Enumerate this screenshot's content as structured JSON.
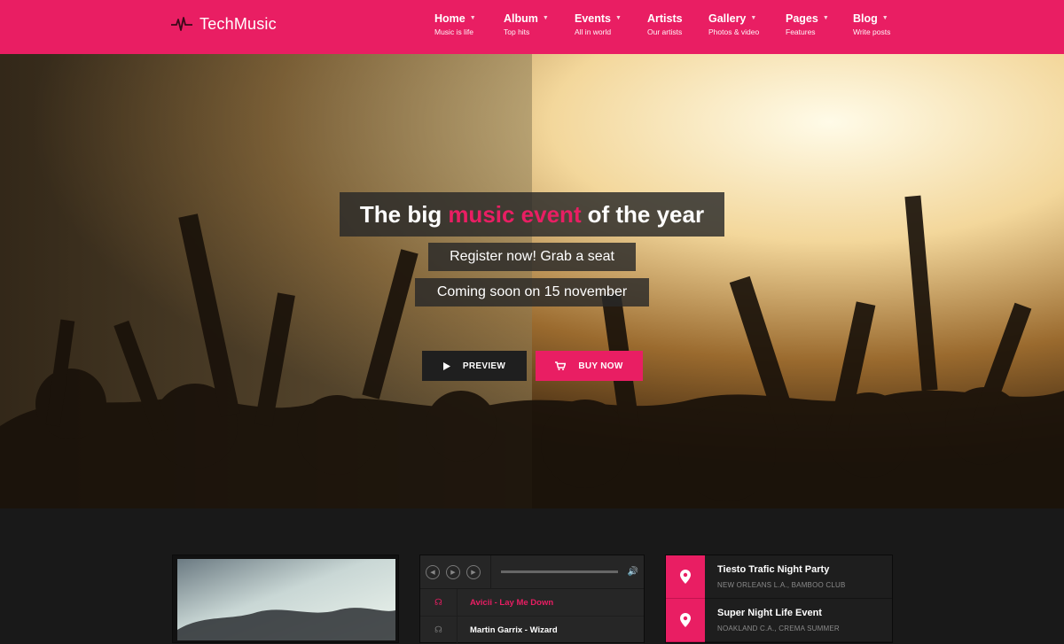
{
  "brand": {
    "name": "TechMusic",
    "logo_icon": "pulse-icon"
  },
  "nav": [
    {
      "title": "Home",
      "sub": "Music is life",
      "dropdown": true
    },
    {
      "title": "Album",
      "sub": "Top hits",
      "dropdown": true
    },
    {
      "title": "Events",
      "sub": "All in world",
      "dropdown": true
    },
    {
      "title": "Artists",
      "sub": "Our artists",
      "dropdown": false
    },
    {
      "title": "Gallery",
      "sub": "Photos & video",
      "dropdown": true
    },
    {
      "title": "Pages",
      "sub": "Features",
      "dropdown": true
    },
    {
      "title": "Blog",
      "sub": "Write posts",
      "dropdown": true
    }
  ],
  "hero": {
    "headline_pre": "The big",
    "headline_accent": "music event",
    "headline_post": "of the year",
    "sub1": "Register now! Grab a seat",
    "sub2": "Coming soon on 15 november",
    "btn_preview": "PREVIEW",
    "btn_buy": "BUY NOW"
  },
  "player": {
    "tracks": [
      {
        "name": "Avicii - Lay Me Down",
        "active": true
      },
      {
        "name": "Martin Garrix - Wizard",
        "active": false
      }
    ]
  },
  "events": [
    {
      "title": "Tiesto Trafic Night Party",
      "location": "NEW ORLEANS L.A., BAMBOO CLUB"
    },
    {
      "title": "Super Night Life Event",
      "location": "NOAKLAND C.A., CREMA SUMMER"
    }
  ],
  "colors": {
    "accent": "#e91e63",
    "dark": "#191919"
  }
}
